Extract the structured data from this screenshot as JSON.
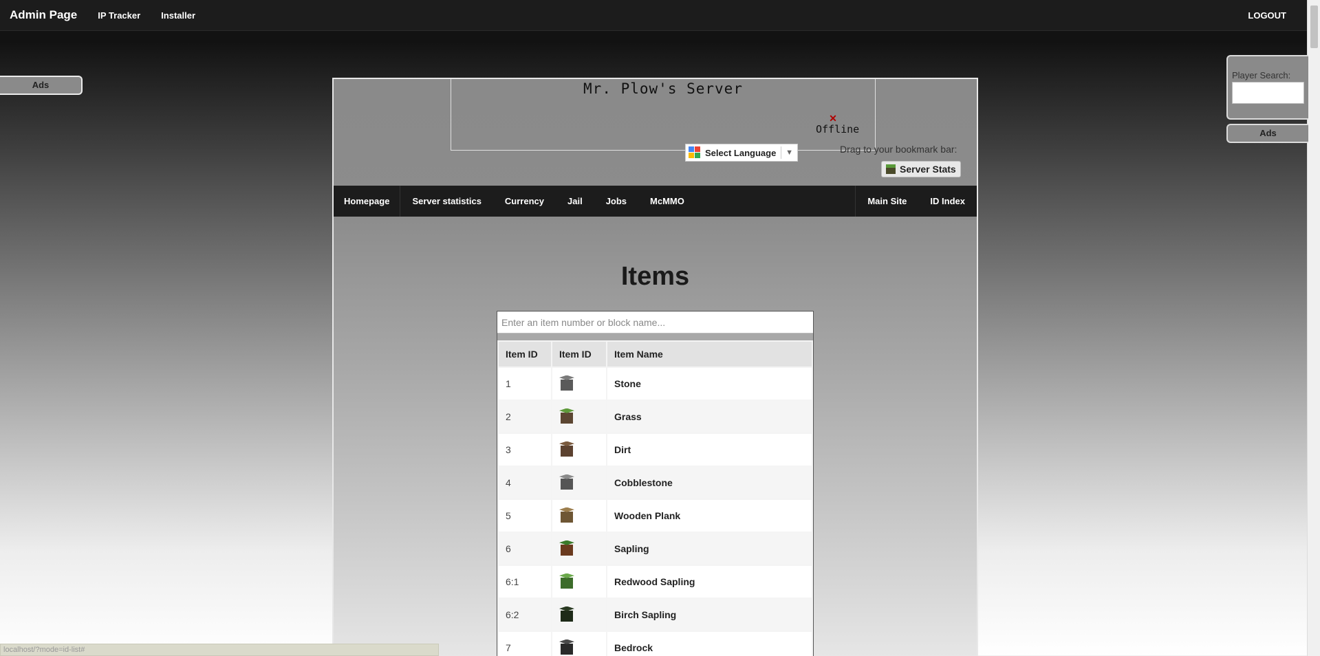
{
  "topbar": {
    "brand": "Admin Page",
    "links": [
      "IP Tracker",
      "Installer"
    ],
    "logout": "LOGOUT"
  },
  "ads_left": "Ads",
  "player_search": {
    "label": "Player Search:"
  },
  "ads_right": "Ads",
  "banner": {
    "server_name": "Mr. Plow's Server",
    "status": "Offline"
  },
  "language": {
    "label": "Select Language",
    "arrow": "▼"
  },
  "bookmark": {
    "text": "Drag to your bookmark bar:",
    "button": "Server Stats"
  },
  "nav": {
    "left": [
      "Homepage",
      "Server statistics",
      "Currency",
      "Jail",
      "Jobs",
      "McMMO"
    ],
    "right": [
      "Main Site",
      "ID Index"
    ]
  },
  "page_title": "Items",
  "search": {
    "placeholder": "Enter an item number or block name..."
  },
  "table": {
    "headers": [
      "Item ID",
      "Item ID",
      "Item Name"
    ],
    "rows": [
      {
        "id": "1",
        "name": "Stone",
        "icon": "stone-icon",
        "top": "#7a7a7a",
        "body": "#5a5a5a"
      },
      {
        "id": "2",
        "name": "Grass",
        "icon": "grass-icon",
        "top": "#5e9a3a",
        "body": "#5c4632"
      },
      {
        "id": "3",
        "name": "Dirt",
        "icon": "dirt-icon",
        "top": "#7a5a3e",
        "body": "#5c4230"
      },
      {
        "id": "4",
        "name": "Cobblestone",
        "icon": "cobblestone-icon",
        "top": "#8a8a8a",
        "body": "#555555"
      },
      {
        "id": "5",
        "name": "Wooden Plank",
        "icon": "wooden-plank-icon",
        "top": "#9c7e4e",
        "body": "#6e5634"
      },
      {
        "id": "6",
        "name": "Sapling",
        "icon": "sapling-icon",
        "top": "#3a7a2a",
        "body": "#6a3a1e"
      },
      {
        "id": "6:1",
        "name": "Redwood Sapling",
        "icon": "redwood-sapling-icon",
        "top": "#6aa84a",
        "body": "#3c6c2a"
      },
      {
        "id": "6:2",
        "name": "Birch Sapling",
        "icon": "birch-sapling-icon",
        "top": "#2a3a22",
        "body": "#1e2a18"
      },
      {
        "id": "7",
        "name": "Bedrock",
        "icon": "bedrock-icon",
        "top": "#4a4a4a",
        "body": "#2a2a2a"
      }
    ]
  },
  "statusbar": "localhost/?mode=id-list#"
}
